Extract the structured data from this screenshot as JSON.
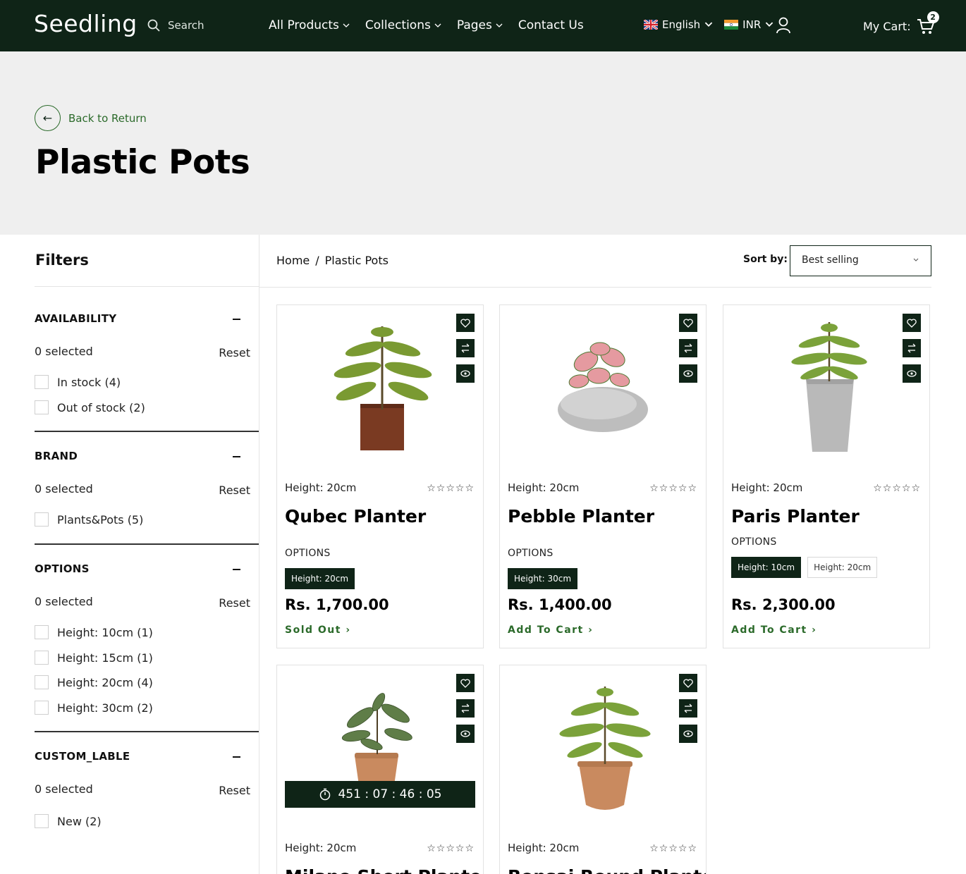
{
  "header": {
    "logo": "Seedling",
    "search_placeholder": "Search",
    "nav": [
      {
        "label": "All Products"
      },
      {
        "label": "Collections"
      },
      {
        "label": "Pages"
      },
      {
        "label": "Contact Us"
      }
    ],
    "language": "English",
    "currency": "INR",
    "cart_label": "My Cart:",
    "cart_count": "2"
  },
  "hero": {
    "back_label": "Back to Return",
    "back_arrow": "←",
    "title": "Plastic Pots"
  },
  "filters": {
    "title": "Filters",
    "groups": [
      {
        "title": "AVAILABILITY",
        "selected": "0 selected",
        "reset": "Reset",
        "options": [
          "In stock (4)",
          "Out of stock (2)"
        ]
      },
      {
        "title": "BRAND",
        "selected": "0 selected",
        "reset": "Reset",
        "options": [
          "Plants&Pots (5)"
        ]
      },
      {
        "title": "OPTIONS",
        "selected": "0 selected",
        "reset": "Reset",
        "options": [
          "Height: 10cm (1)",
          "Height: 15cm (1)",
          "Height: 20cm (4)",
          "Height: 30cm (2)"
        ]
      },
      {
        "title": "CUSTOM_LABLE",
        "selected": "0 selected",
        "reset": "Reset",
        "options": [
          "New (2)"
        ]
      }
    ]
  },
  "breadcrumb": {
    "home": "Home",
    "sep": "/",
    "current": "Plastic Pots"
  },
  "sort": {
    "label": "Sort by:",
    "value": "Best selling"
  },
  "products": [
    {
      "height": "Height: 20cm",
      "stars": "☆☆☆☆☆",
      "name": "Qubec Planter",
      "options_label": "OPTIONS",
      "options": [
        "Height: 20cm"
      ],
      "price": "Rs. 1,700.00",
      "cta": "Sold Out ›"
    },
    {
      "height": "Height: 20cm",
      "stars": "☆☆☆☆☆",
      "name": "Pebble Planter",
      "options_label": "OPTIONS",
      "options": [
        "Height: 30cm"
      ],
      "price": "Rs. 1,400.00",
      "cta": "Add To Cart ›"
    },
    {
      "height": "Height: 20cm",
      "stars": "☆☆☆☆☆",
      "name": "Paris Planter",
      "options_label": "OPTIONS",
      "options": [
        "Height: 10cm",
        "Height: 20cm"
      ],
      "price": "Rs. 2,300.00",
      "cta": "Add To Cart ›"
    },
    {
      "height": "Height: 20cm",
      "stars": "☆☆☆☆☆",
      "name": "Milano Short Planter",
      "timer": "451  :  07  :  46  :  05"
    },
    {
      "height": "Height: 20cm",
      "stars": "☆☆☆☆☆",
      "name": "Bonsai Round Planter"
    }
  ],
  "colors": {
    "brand_dark": "#0f2417",
    "accent_green": "#2b6a2a",
    "hero_bg": "#efefef"
  }
}
